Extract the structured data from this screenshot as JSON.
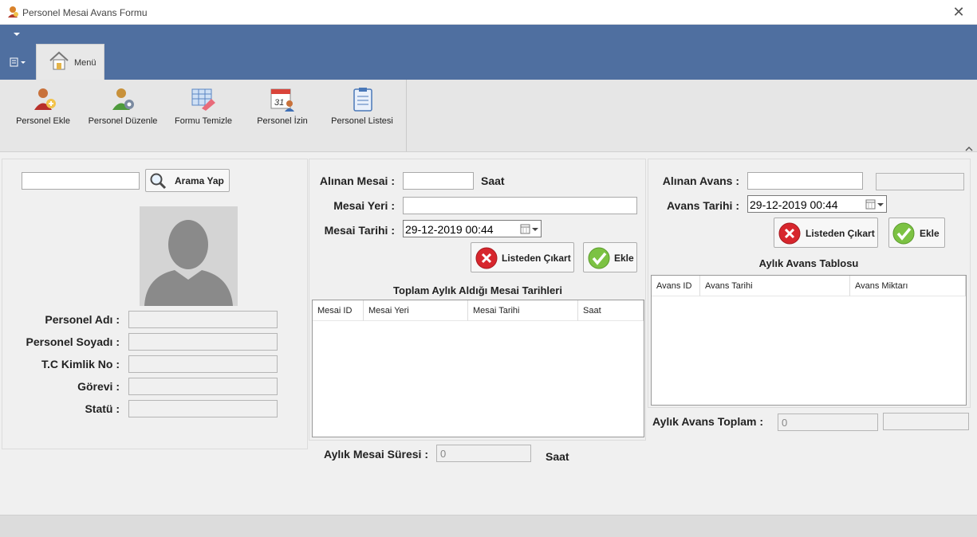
{
  "window": {
    "title": "Personel Mesai Avans Formu",
    "close_glyph": "✕"
  },
  "ribbon": {
    "menu_tab": "Menü",
    "buttons": [
      {
        "label": "Personel Ekle",
        "icon": "add-person-icon"
      },
      {
        "label": "Personel Düzenle",
        "icon": "edit-person-icon"
      },
      {
        "label": "Formu Temizle",
        "icon": "eraser-icon"
      },
      {
        "label": "Personel İzin",
        "icon": "calendar-person-icon"
      },
      {
        "label": "Personel Listesi",
        "icon": "clipboard-icon"
      }
    ]
  },
  "left_panel": {
    "search_value": "",
    "search_button": "Arama Yap",
    "fields": [
      {
        "label": "Personel Adı :",
        "value": ""
      },
      {
        "label": "Personel Soyadı :",
        "value": ""
      },
      {
        "label": "T.C Kimlik No :",
        "value": ""
      },
      {
        "label": "Görevi :",
        "value": ""
      },
      {
        "label": "Statü :",
        "value": ""
      }
    ]
  },
  "mesai": {
    "alinan_label": "Alınan Mesai :",
    "alinan_value": "",
    "unit": "Saat",
    "yeri_label": "Mesai Yeri :",
    "yeri_value": "",
    "tarih_label": "Mesai Tarihi :",
    "tarih_value": "29-12-2019 00:44",
    "remove_button": "Listeden Çıkart",
    "add_button": "Ekle",
    "table_title": "Toplam Aylık Aldığı Mesai Tarihleri",
    "columns": [
      "Mesai ID",
      "Mesai Yeri",
      "Mesai Tarihi",
      "Saat"
    ],
    "rows": [],
    "total_label": "Aylık Mesai Süresi :",
    "total_value": "0",
    "total_unit": "Saat"
  },
  "avans": {
    "alinan_label": "Alınan Avans :",
    "alinan_value": "",
    "extra_value": "",
    "tarih_label": "Avans Tarihi :",
    "tarih_value": "29-12-2019 00:44",
    "remove_button": "Listeden Çıkart",
    "add_button": "Ekle",
    "table_title": "Aylık Avans Tablosu",
    "columns": [
      "Avans ID",
      "Avans Tarihi",
      "Avans Miktarı"
    ],
    "rows": [],
    "total_label": "Aylık Avans Toplam :",
    "total_value": "0",
    "total_extra": ""
  }
}
